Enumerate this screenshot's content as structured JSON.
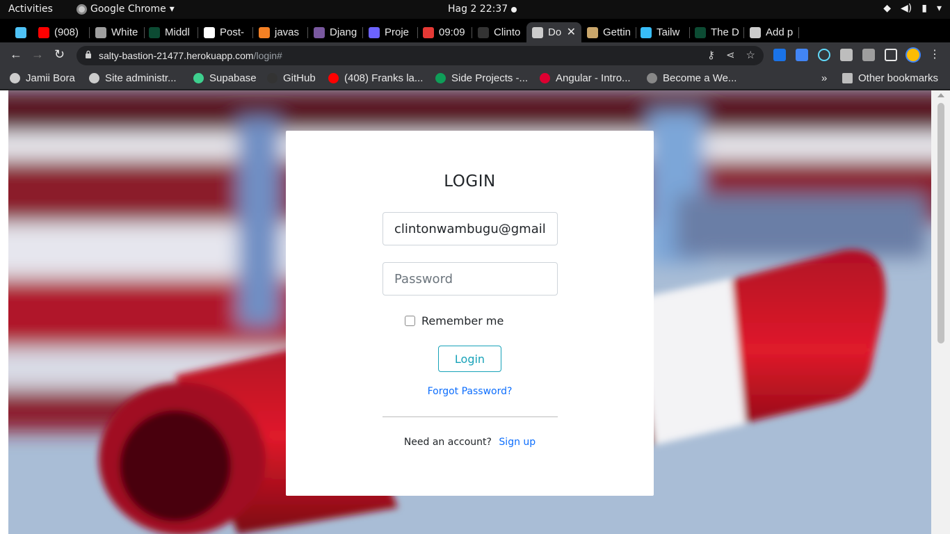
{
  "system_bar": {
    "activities": "Activities",
    "app_name": "Google Chrome",
    "clock": "Hag 2  22:37"
  },
  "tabs": [
    {
      "label": "",
      "icon": "gem-icon",
      "color": "#4fc3f7"
    },
    {
      "label": "(908) ",
      "icon": "youtube-icon",
      "color": "#ff0000"
    },
    {
      "label": "White",
      "icon": "building-icon",
      "color": "#9e9e9e"
    },
    {
      "label": "Middl",
      "icon": "django-icon",
      "color": "#0c4b33"
    },
    {
      "label": "Post-",
      "icon": "google-icon",
      "color": "#ffffff"
    },
    {
      "label": "javas",
      "icon": "stackoverflow-icon",
      "color": "#f48024"
    },
    {
      "label": "Djang",
      "icon": "heroku-icon",
      "color": "#79589f"
    },
    {
      "label": "Proje",
      "icon": "project-icon",
      "color": "#6c63ff"
    },
    {
      "label": "09:09",
      "icon": "check-circle-icon",
      "color": "#e53935"
    },
    {
      "label": "Clinto",
      "icon": "github-icon",
      "color": "#333333"
    },
    {
      "label": "Do",
      "icon": "globe-icon",
      "color": "#cccccc",
      "active": true
    },
    {
      "label": "Gettin",
      "icon": "owl-icon",
      "color": "#c9a66b"
    },
    {
      "label": "Tailw",
      "icon": "tailwind-icon",
      "color": "#38bdf8"
    },
    {
      "label": "The D",
      "icon": "django-icon",
      "color": "#0c4b33"
    },
    {
      "label": "Add p",
      "icon": "globe-icon",
      "color": "#cccccc"
    }
  ],
  "address_bar": {
    "host": "salty-bastion-21477.herokuapp.com",
    "path": "/login#"
  },
  "bookmarks": [
    {
      "label": "Jamii Bora",
      "icon": "gear-icon",
      "color": "#cccccc"
    },
    {
      "label": "Site administr...",
      "icon": "globe-icon",
      "color": "#cccccc"
    },
    {
      "label": "Supabase",
      "icon": "supabase-icon",
      "color": "#3ecf8e"
    },
    {
      "label": "GitHub",
      "icon": "github-icon",
      "color": "#333333"
    },
    {
      "label": "(408) Franks la...",
      "icon": "youtube-icon",
      "color": "#ff0000"
    },
    {
      "label": "Side Projects -...",
      "icon": "sheets-icon",
      "color": "#0f9d58"
    },
    {
      "label": "Angular - Intro...",
      "icon": "angular-icon",
      "color": "#dd0031"
    },
    {
      "label": "Become a We...",
      "icon": "vue-icon",
      "color": "#888888"
    }
  ],
  "bookmarks_overflow": "»",
  "other_bookmarks": "Other bookmarks",
  "login": {
    "title": "LOGIN",
    "email_value": "clintonwambugu@gmail",
    "password_placeholder": "Password",
    "remember_label": "Remember me",
    "login_button": "Login",
    "forgot_link": "Forgot Password?",
    "need_account": "Need an account?",
    "signup_link": "Sign up"
  }
}
